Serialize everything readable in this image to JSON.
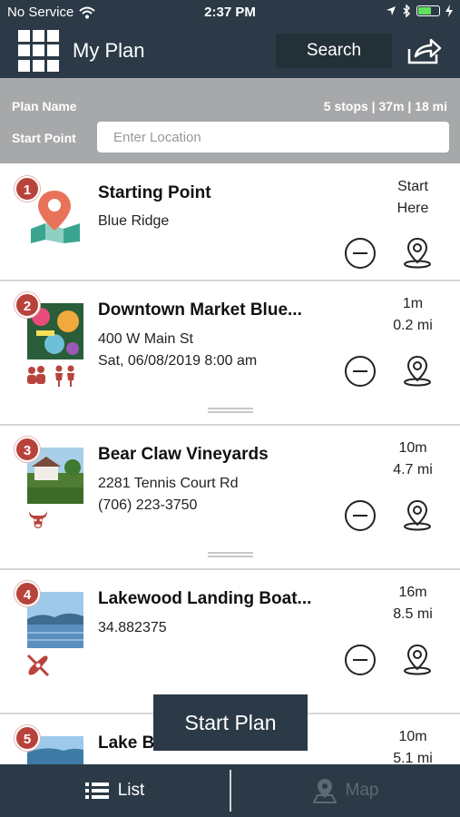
{
  "status": {
    "carrier": "No Service",
    "time": "2:37 PM"
  },
  "header": {
    "title": "My Plan",
    "search_label": "Search"
  },
  "plan": {
    "name_label": "Plan Name",
    "stats": "5 stops | 37m | 18 mi",
    "start_label": "Start Point",
    "location_placeholder": "Enter Location",
    "location_value": ""
  },
  "stops": [
    {
      "num": "1",
      "title": "Starting Point",
      "line1": "Blue Ridge",
      "line2": "",
      "right1": "Start",
      "right2": "Here",
      "category": "map-pin-icon"
    },
    {
      "num": "2",
      "title": "Downtown Market Blue...",
      "line1": "400 W Main St",
      "line2": "Sat, 06/08/2019 8:00 am",
      "right1": "1m",
      "right2": "0.2 mi",
      "category": "family-icon"
    },
    {
      "num": "3",
      "title": "Bear Claw Vineyards",
      "line1": "2281 Tennis Court Rd",
      "line2": "(706) 223-3750",
      "right1": "10m",
      "right2": "4.7 mi",
      "category": "bull-icon"
    },
    {
      "num": "4",
      "title": "Lakewood Landing Boat...",
      "line1": "34.882375",
      "line2": "",
      "right1": "16m",
      "right2": "8.5 mi",
      "category": "kayak-icon"
    },
    {
      "num": "5",
      "title": "Lake B...",
      "line1": "",
      "line2": "",
      "right1": "10m",
      "right2": "5.1 mi",
      "category": ""
    }
  ],
  "start_plan_label": "Start Plan",
  "tabs": {
    "list_label": "List",
    "map_label": "Map"
  },
  "colors": {
    "navbar": "#2b3a46",
    "accent": "#b8433c",
    "planbar": "#a6a8aa"
  }
}
